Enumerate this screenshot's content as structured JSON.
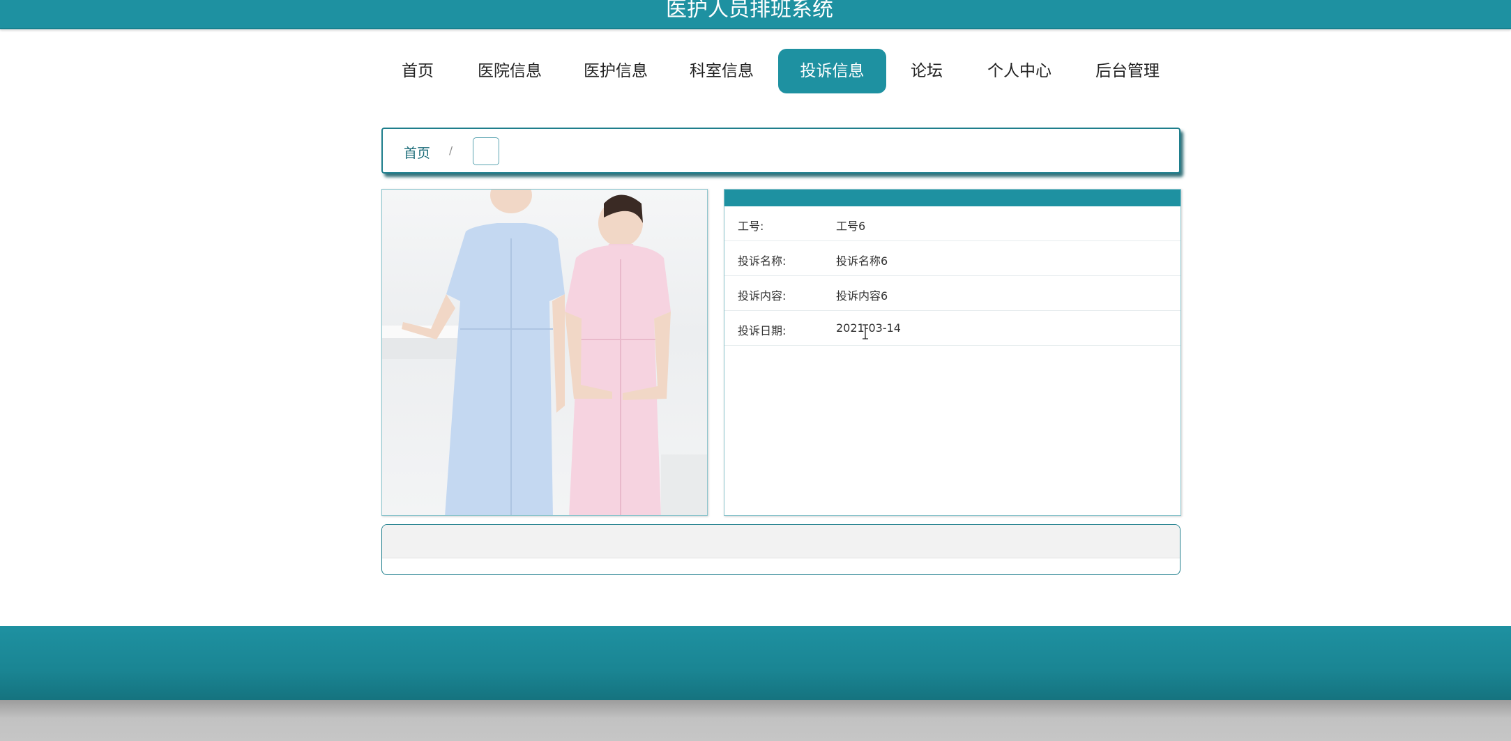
{
  "header": {
    "title": "医护人员排班系统"
  },
  "nav": {
    "items": [
      {
        "label": "首页"
      },
      {
        "label": "医院信息"
      },
      {
        "label": "医护信息"
      },
      {
        "label": "科室信息"
      },
      {
        "label": "投诉信息"
      },
      {
        "label": "论坛"
      },
      {
        "label": "个人中心"
      },
      {
        "label": "后台管理"
      }
    ],
    "active_index": 4
  },
  "breadcrumb": {
    "home": "首页",
    "separator": "/",
    "current": ""
  },
  "detail": {
    "rows": [
      {
        "label": "工号:",
        "value": "工号6"
      },
      {
        "label": "投诉名称:",
        "value": "投诉名称6"
      },
      {
        "label": "投诉内容:",
        "value": "投诉内容6"
      },
      {
        "label": "投诉日期:",
        "value": "2021-03-14"
      }
    ]
  },
  "colors": {
    "primary": "#1e91a1",
    "border": "#1e7e8c"
  }
}
